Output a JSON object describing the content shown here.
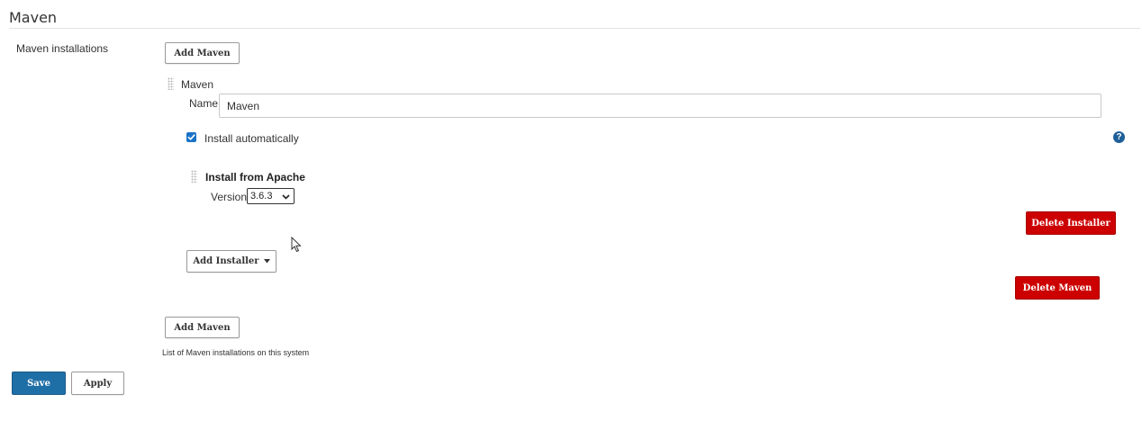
{
  "section": {
    "title": "Maven"
  },
  "installations_label": "Maven installations",
  "add_maven_label": "Add Maven",
  "installation": {
    "header": "Maven",
    "name_label": "Name",
    "name_value": "Maven",
    "install_auto_label": "Install automatically",
    "install_auto_checked": true,
    "installer": {
      "title": "Install from Apache",
      "version_label": "Version",
      "version_value": "3.6.3"
    },
    "delete_installer_label": "Delete Installer",
    "add_installer_label": "Add Installer",
    "delete_maven_label": "Delete Maven"
  },
  "help_text": "List of Maven installations on this system",
  "footer": {
    "save_label": "Save",
    "apply_label": "Apply"
  },
  "colors": {
    "accent_blue": "#1f6fa7",
    "danger_red": "#cc0000",
    "checkbox_blue": "#1a73c8"
  },
  "icons": {
    "help": "question-mark-icon",
    "handle": "drag-handle-icon",
    "dropdown": "caret-down-icon",
    "checkbox": "checkmark-icon"
  }
}
